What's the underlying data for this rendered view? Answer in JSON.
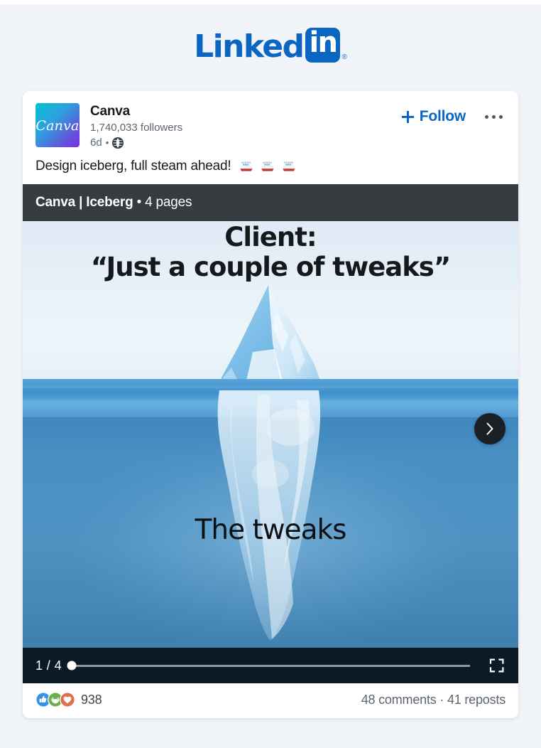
{
  "brand": {
    "wordmark_primary": "Linked",
    "wordmark_boxed": "in",
    "registered_mark": "®",
    "accent_color": "#0a66c2"
  },
  "post": {
    "author": {
      "name": "Canva",
      "avatar_text": "Canva",
      "followers": "1,740,033 followers",
      "time_ago": "6d",
      "separator": "•",
      "visibility_icon": "globe-icon"
    },
    "actions": {
      "follow_label": "Follow",
      "follow_icon": "plus-icon",
      "more_icon": "ellipsis-icon"
    },
    "text": "Design iceberg, full steam ahead!",
    "emojis": [
      "ship-emoji",
      "ship-emoji",
      "ship-emoji"
    ]
  },
  "carousel": {
    "title_bold": "Canva | Iceberg",
    "title_meta": " • 4 pages",
    "document_name": "Canva | Iceberg",
    "page_count": "4 pages",
    "slide": {
      "title_line1": "Client:",
      "title_line2": "“Just a couple of tweaks”",
      "caption": "The tweaks",
      "image_alt": "iceberg-illustration"
    },
    "next_icon": "chevron-right-icon",
    "page_counter": "1 / 4",
    "current_page": 1,
    "total_pages": 4,
    "progress_percent": 0,
    "fullscreen_icon": "fullscreen-icon",
    "topbar_color": "#373c41",
    "bottombar_color": "#0c1a25"
  },
  "social": {
    "reaction_icons": [
      "like-icon",
      "funny-icon",
      "love-icon"
    ],
    "reaction_count": "938",
    "engagement": "48 comments · 41 reposts",
    "comments": "48 comments",
    "reposts": "41 reposts"
  }
}
